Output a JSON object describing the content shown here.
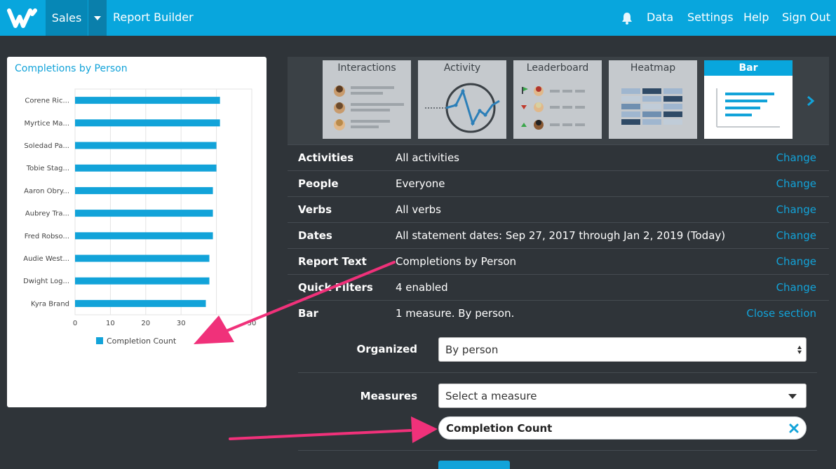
{
  "topbar": {
    "workspace": "Sales",
    "breadcrumb": "Report Builder",
    "nav": [
      "Data",
      "Settings",
      "Help",
      "Sign Out"
    ],
    "accent": "#08a6dd"
  },
  "chart_data": {
    "type": "bar",
    "orientation": "horizontal",
    "title": "Completions by Person",
    "categories": [
      "Corene Ric...",
      "Myrtice Ma...",
      "Soledad Pa...",
      "Tobie Stag...",
      "Aaron Obry...",
      "Aubrey Tra...",
      "Fred Robso...",
      "Audie West...",
      "Dwight Log...",
      "Kyra Brand"
    ],
    "series": [
      {
        "name": "Completion Count",
        "values": [
          41,
          41,
          40,
          40,
          39,
          39,
          39,
          38,
          38,
          37
        ]
      }
    ],
    "xlim": [
      0,
      50
    ],
    "xticks": [
      "0",
      "10",
      "20",
      "30",
      "40",
      "50"
    ],
    "grid": true,
    "legend": "bottom",
    "color": "#12a3d9"
  },
  "report_types": [
    "Interactions",
    "Activity",
    "Leaderboard",
    "Heatmap",
    "Bar"
  ],
  "active_type": "Bar",
  "settings": [
    {
      "label": "Activities",
      "value": "All activities",
      "action": "Change"
    },
    {
      "label": "People",
      "value": "Everyone",
      "action": "Change"
    },
    {
      "label": "Verbs",
      "value": "All verbs",
      "action": "Change"
    },
    {
      "label": "Dates",
      "value": "All statement dates: Sep 27, 2017 through Jan 2, 2019 (Today)",
      "action": "Change"
    },
    {
      "label": "Report Text",
      "value": "Completions by Person",
      "action": "Change"
    },
    {
      "label": "Quick Filters",
      "value": "4 enabled",
      "action": "Change"
    },
    {
      "label": "Bar",
      "value": "1 measure. By person.",
      "action": "Close section"
    }
  ],
  "bar_section": {
    "organized_label": "Organized",
    "organized_value": "By person",
    "measures_label": "Measures",
    "measures_placeholder": "Select a measure",
    "selected_measure": "Completion Count"
  }
}
